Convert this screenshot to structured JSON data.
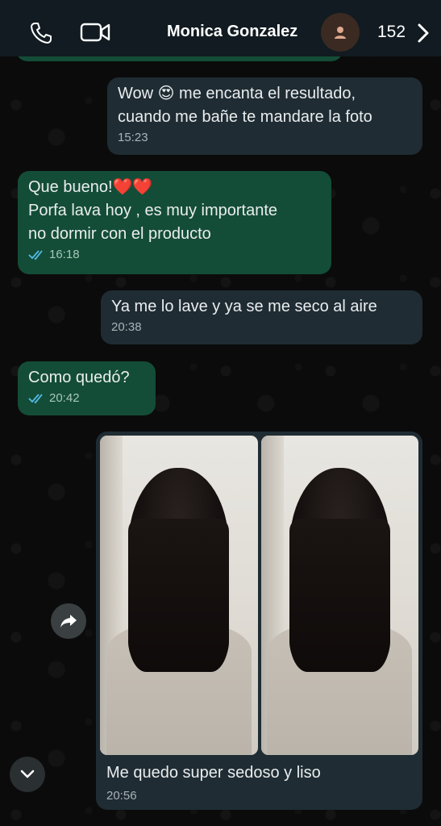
{
  "header": {
    "contact_name": "Monica Gonzalez",
    "unread_count": "152",
    "icons": [
      "phone-icon",
      "video-call-icon",
      "avatar-person-icon",
      "chevron-right-icon"
    ]
  },
  "messages": [
    {
      "direction": "incoming",
      "text": "Wow 😍 me encanta el resultado,\ncuando me bañe te mandare la foto",
      "time": "15:23"
    },
    {
      "direction": "outgoing",
      "text": "Que bueno!❤️❤️\nPorfa lava hoy , es muy importante\nno dormir con el producto",
      "time": "16:18",
      "status": "read"
    },
    {
      "direction": "incoming",
      "text": "Ya me lo lave y ya se me seco al aire",
      "time": "20:38"
    },
    {
      "direction": "outgoing",
      "text": "Como quedó?",
      "time": "20:42",
      "status": "read"
    },
    {
      "direction": "incoming",
      "type": "photo-album",
      "photo_count": 2,
      "caption": "Me quedo super sedoso y liso",
      "time": "20:56"
    }
  ],
  "colors": {
    "header_bg": "#111b21",
    "incoming_bubble": "#1f2c33",
    "outgoing_bubble": "#144d37",
    "read_ticks": "#53bdeb"
  }
}
